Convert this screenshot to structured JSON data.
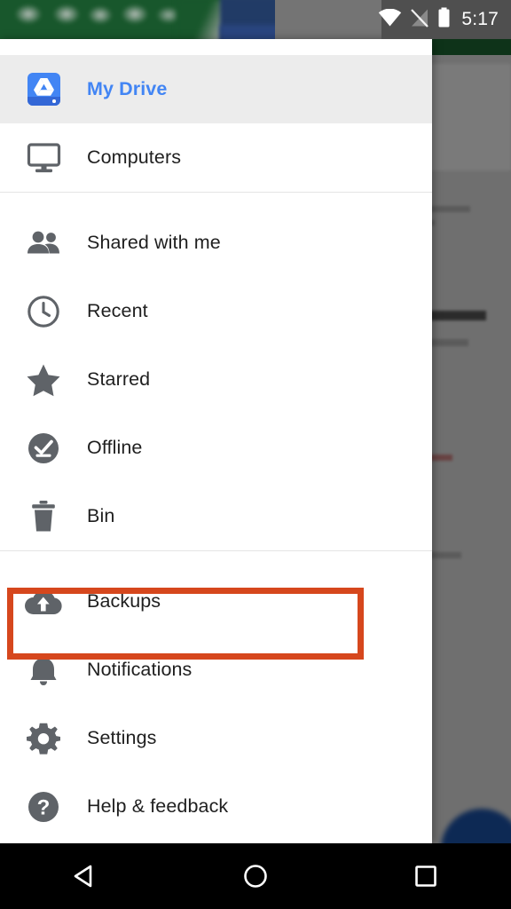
{
  "status_bar": {
    "time": "5:17",
    "icons": [
      "wifi-icon",
      "signal-off-icon",
      "battery-icon"
    ]
  },
  "drawer": {
    "groups": [
      {
        "items": [
          {
            "label": "My Drive",
            "icon": "drive-icon",
            "selected": true
          },
          {
            "label": "Computers",
            "icon": "computer-monitor-icon",
            "selected": false
          }
        ]
      },
      {
        "items": [
          {
            "label": "Shared with me",
            "icon": "people-icon",
            "selected": false
          },
          {
            "label": "Recent",
            "icon": "clock-icon",
            "selected": false
          },
          {
            "label": "Starred",
            "icon": "star-icon",
            "selected": false
          },
          {
            "label": "Offline",
            "icon": "offline-check-icon",
            "selected": false
          },
          {
            "label": "Bin",
            "icon": "trash-icon",
            "selected": false
          }
        ]
      },
      {
        "items": [
          {
            "label": "Backups",
            "icon": "cloud-upload-icon",
            "selected": false
          },
          {
            "label": "Notifications",
            "icon": "bell-icon",
            "selected": false
          },
          {
            "label": "Settings",
            "icon": "gear-icon",
            "selected": false
          },
          {
            "label": "Help & feedback",
            "icon": "help-circle-icon",
            "selected": false
          }
        ]
      }
    ]
  },
  "highlight": {
    "target_label": "Backups",
    "color": "#d6471d"
  },
  "nav_bar": {
    "back": "back-triangle-icon",
    "home": "home-circle-icon",
    "recents": "recents-square-icon"
  },
  "colors": {
    "accent_blue": "#4285f4",
    "selected_row_bg": "#ececec",
    "icon_gray": "#5f6368",
    "highlight_orange": "#d6471d",
    "scrim": "rgba(0,0,0,0.52)"
  }
}
